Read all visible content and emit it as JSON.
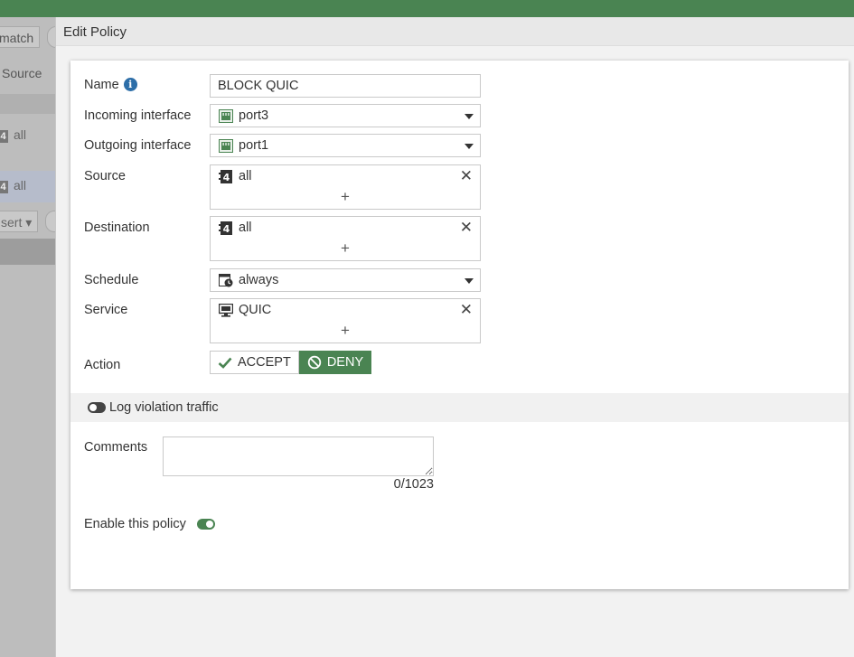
{
  "background": {
    "match_label": "match",
    "source_column": "Source",
    "row1_all": "all",
    "row2_all": "all",
    "insert_label": "sert",
    "badge_text": "4"
  },
  "dialog": {
    "title": "Edit Policy"
  },
  "form": {
    "name_label": "Name",
    "name_value": "BLOCK QUIC",
    "incoming_label": "Incoming interface",
    "incoming_value": "port3",
    "outgoing_label": "Outgoing interface",
    "outgoing_value": "port1",
    "source_label": "Source",
    "source_value": "all",
    "destination_label": "Destination",
    "destination_value": "all",
    "address_badge": "4",
    "schedule_label": "Schedule",
    "schedule_value": "always",
    "service_label": "Service",
    "service_value": "QUIC",
    "add_symbol": "+",
    "remove_symbol": "✕",
    "action_label": "Action",
    "accept_label": "ACCEPT",
    "deny_label": "DENY",
    "selected_action": "DENY",
    "log_label": "Log violation traffic",
    "log_enabled": false,
    "comments_label": "Comments",
    "comments_value": "",
    "comments_counter": "0/1023",
    "enable_label": "Enable this policy",
    "enable_state": true,
    "info_glyph": "i"
  },
  "colors": {
    "accent": "#4a8452",
    "info": "#2d6ea8"
  }
}
